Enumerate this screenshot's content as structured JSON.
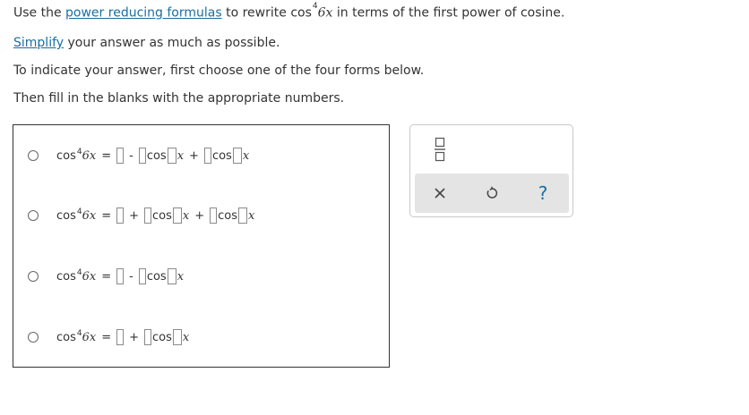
{
  "instructions": {
    "line1_prefix": "Use the ",
    "line1_link": "power reducing formulas",
    "line1_middle": " to rewrite ",
    "line1_cos": "cos",
    "line1_exp": "4",
    "line1_arg": "6x",
    "line1_suffix": " in terms of the first power of cosine.",
    "line2_link": "Simplify",
    "line2_suffix": " your answer as much as possible.",
    "line3": "To indicate your answer, first choose one of the four forms below.",
    "line4": "Then fill in the blanks with the appropriate numbers."
  },
  "options": [
    {
      "lhs": "cos",
      "exp": "4",
      "arg": "6x",
      "eq": "=",
      "ops": [
        "-",
        "+"
      ]
    },
    {
      "lhs": "cos",
      "exp": "4",
      "arg": "6x",
      "eq": "=",
      "ops": [
        "+",
        "+"
      ]
    },
    {
      "lhs": "cos",
      "exp": "4",
      "arg": "6x",
      "eq": "=",
      "ops": [
        "-"
      ]
    },
    {
      "lhs": "cos",
      "exp": "4",
      "arg": "6x",
      "eq": "=",
      "ops": [
        "+"
      ]
    }
  ],
  "terms": {
    "cos": "cos",
    "x": "x"
  },
  "toolbar": {
    "icons": [
      "fraction-icon",
      "clear-icon",
      "undo-icon",
      "help-icon"
    ],
    "help_label": "?"
  },
  "colors": {
    "link": "#1a6fa0",
    "toolbar_bg": "#e4e4e4",
    "border": "#333333"
  }
}
